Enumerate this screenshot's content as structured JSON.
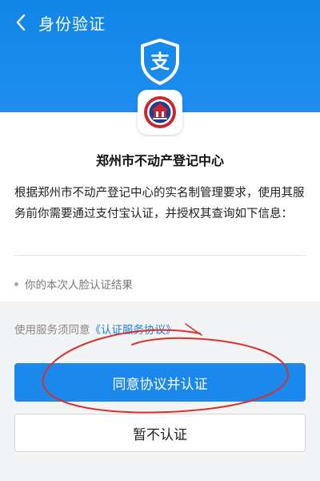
{
  "header": {
    "title": "身份验证",
    "back_icon": "chevron-left-icon",
    "logo_icon": "alipay-shield-icon",
    "logo_glyph": "支"
  },
  "organization": {
    "logo_icon": "real-estate-registration-center-emblem-icon",
    "name": "郑州市不动产登记中心"
  },
  "description": "根据郑州市不动产登记中心的实名制管理要求，使用其服务前你需要通过支付宝认证，并授权其查询如下信息：",
  "info_items": [
    "你的本次人脸认证结果"
  ],
  "agreement": {
    "prefix": "使用服务须同意",
    "link_text": "《认证服务协议》"
  },
  "buttons": {
    "agree_label": "同意协议并认证",
    "decline_label": "暂不认证"
  },
  "colors": {
    "header_blue": "#1186e8",
    "primary_button": "#1b88ee",
    "link": "#1c7fe0",
    "annotation_red": "#d9312b"
  }
}
